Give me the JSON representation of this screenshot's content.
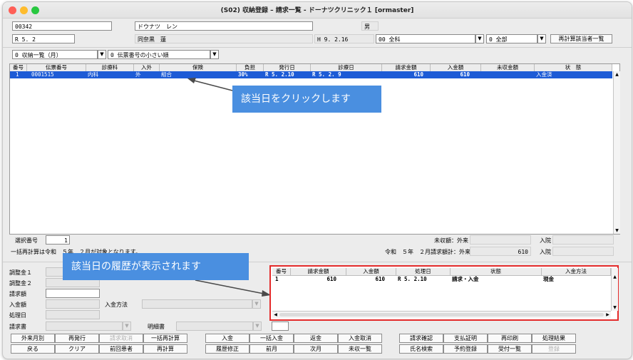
{
  "window": {
    "title": "(S02) 収納登録 – 請求一覧 - ドーナツクリニック１ [ormaster]"
  },
  "patient": {
    "id": "00342",
    "name_kana": "ドウナツ　レン",
    "sex": "男",
    "era_date": "R 5. 2",
    "name_kanji": "同奈黒　蓮",
    "birth": "H 9. 2.16",
    "dept_combo": "00 全科",
    "type_combo": "0 全部",
    "recalc_button": "再計算該当者一覧"
  },
  "filters": {
    "list_combo": "0 収納一覧（月）",
    "sort_combo": "0 伝票番号の小さい順"
  },
  "billing_table": {
    "headers": [
      "番号",
      "伝票番号",
      "診療科",
      "入外",
      "保険",
      "負担",
      "発行日",
      "診療日",
      "請求金額",
      "入金額",
      "未収金額",
      "状　態"
    ],
    "rows": [
      [
        "1",
        "0001515",
        "内科",
        "外",
        "組合",
        "30%",
        "R 5. 2.10",
        "R 5. 2. 9",
        "610",
        "610",
        "",
        "入金済"
      ]
    ]
  },
  "callouts": {
    "click_date": "該当日をクリックします",
    "history_shown": "該当日の履歴が表示されます"
  },
  "summary": {
    "select_label": "選択番号",
    "select_value": "1",
    "note": "一括再計算は令和　５年　２月が対象となります。",
    "uncollected_label": "未収額：外来",
    "inpatient_label_1": "入院",
    "monthly_label": "令和　５年　２月請求額計：外来",
    "monthly_value": "610",
    "inpatient_label_2": "入院"
  },
  "form": {
    "adj1": "調整金１",
    "adj2": "調整金２",
    "billed": "請求額",
    "received": "入金額",
    "pay_method": "入金方法",
    "proc_date": "処理日",
    "invoice": "請求書",
    "statement": "明細書"
  },
  "history_table": {
    "headers": [
      "番号",
      "請求金額",
      "入金額",
      "処理日",
      "状態",
      "入金方法"
    ],
    "rows": [
      [
        "1",
        "610",
        "610",
        "R 5. 2.10",
        "請求・入金",
        "現金"
      ]
    ]
  },
  "buttons_row1": [
    "外来月別",
    "再発行",
    "請求取消",
    "一括再計算",
    "入金",
    "一括入金",
    "返金",
    "入金取消",
    "請求確認",
    "支払証明",
    "再印刷",
    "処理結果"
  ],
  "buttons_row2": [
    "戻る",
    "クリア",
    "前回患者",
    "再計算",
    "履歴修正",
    "前月",
    "次月",
    "未収一覧",
    "氏名検索",
    "予約登録",
    "受付一覧",
    "登録"
  ]
}
